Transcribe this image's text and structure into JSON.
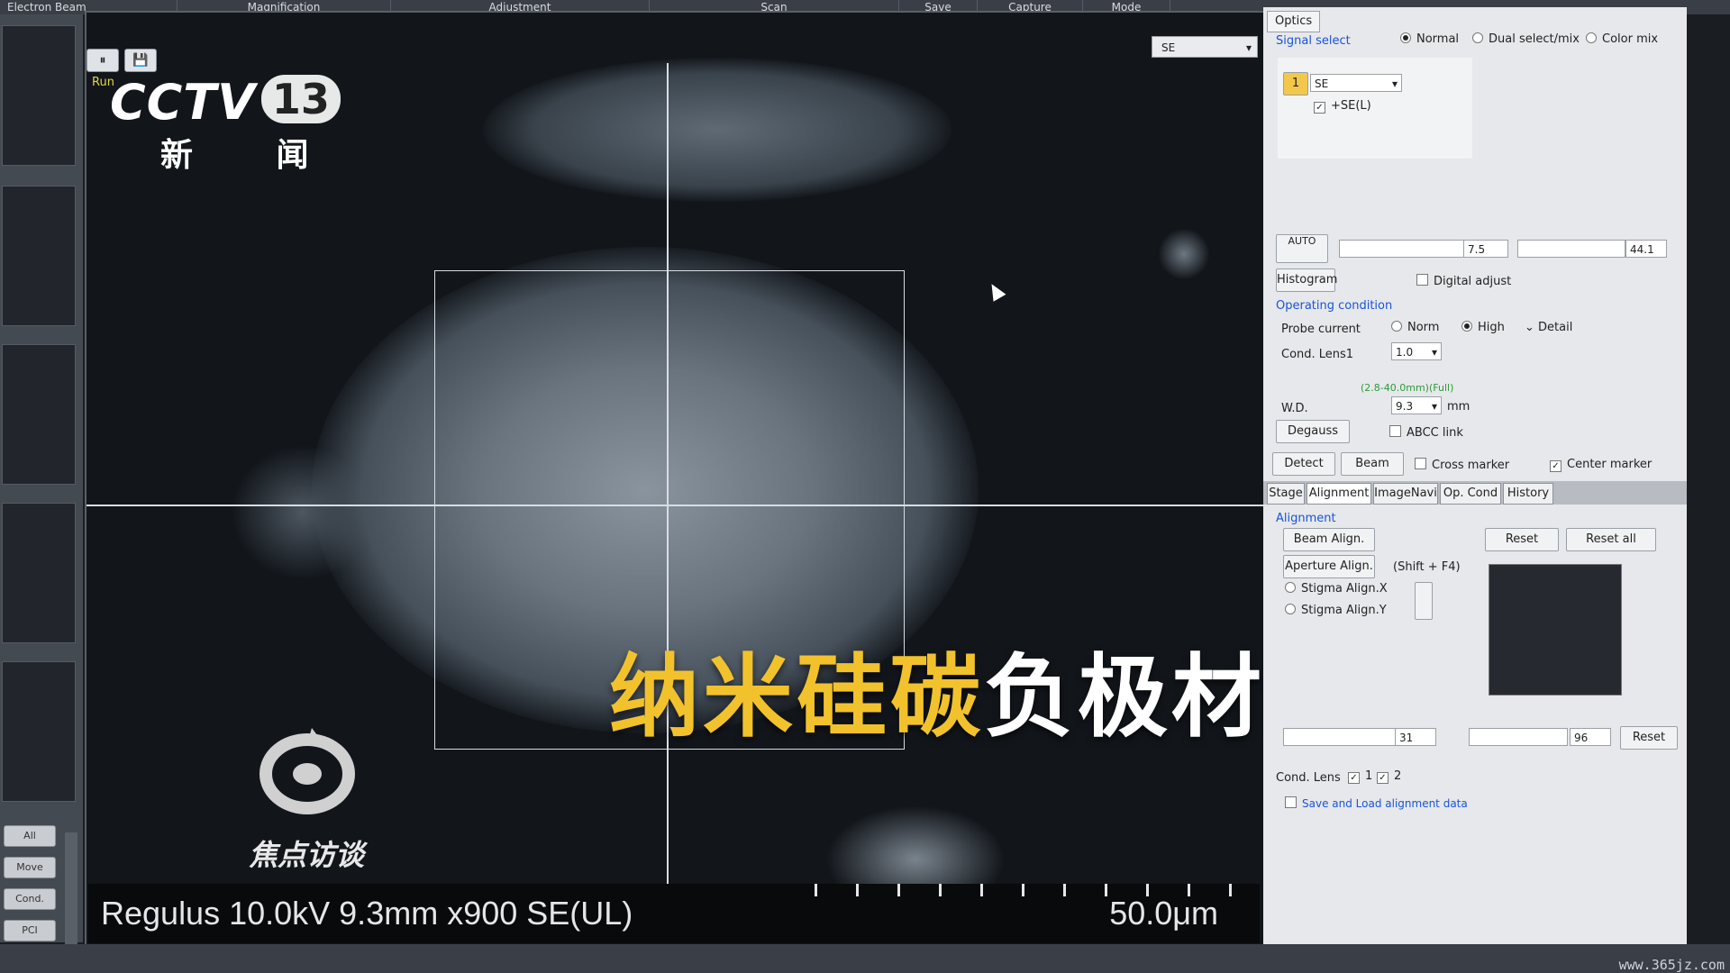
{
  "menu": [
    "Electron Beam",
    "Magnification",
    "Adjustment",
    "Scan",
    "Save",
    "Capture",
    "Mode"
  ],
  "viewer": {
    "run_label": "Run",
    "signal": "SE",
    "info": "Regulus 10.0kV 9.3mm x900 SE(UL)",
    "scale": "50.0μm"
  },
  "left_buttons": [
    "All",
    "Move",
    "Cond.",
    "PCI"
  ],
  "overlay": {
    "channel_logo": "CCTV",
    "channel_number": "13",
    "channel_name": "新 闻",
    "program": "焦点访谈",
    "subtitle_yellow": "纳米硅碳",
    "subtitle_white": "负极材料",
    "watermark": "www.365jz.com"
  },
  "panel": {
    "tab": "Optics",
    "signal_select": "Signal select",
    "modes": [
      "Normal",
      "Dual select/mix",
      "Color mix"
    ],
    "signal_number": "1",
    "signal_value": "SE",
    "signal_sub": "+SE(L)",
    "auto": "AUTO",
    "brightness": "7.5",
    "contrast": "44.1",
    "histogram": "Histogram",
    "digital_adjust": "Digital adjust",
    "operating_condition": "Operating condition",
    "probe_current": "Probe current",
    "probe_opts": [
      "Norm",
      "High",
      "Detail"
    ],
    "cond_lens1": "Cond. Lens1",
    "cond_lens1_val": "1.0",
    "wd_range": "(2.8-40.0mm)(Full)",
    "wd": "W.D.",
    "wd_val": "9.3",
    "wd_unit": "mm",
    "degauss": "Degauss",
    "abcc": "ABCC link",
    "detect": "Detect",
    "beam": "Beam",
    "cross_marker": "Cross marker",
    "center_marker": "Center marker",
    "tabs": [
      "Stage",
      "Alignment",
      "ImageNavi",
      "Op. Cond",
      "History"
    ],
    "alignment": "Alignment",
    "beam_align": "Beam Align.",
    "aperture_align": "Aperture Align.",
    "shortcut": "(Shift + F4)",
    "stigma_x": "Stigma Align.X",
    "stigma_y": "Stigma Align.Y",
    "reset": "Reset",
    "reset_all": "Reset all",
    "val_a": "31",
    "val_b": "96",
    "reset2": "Reset",
    "cond_lens": "Cond. Lens",
    "cl1": "1",
    "cl2": "2",
    "save_load": "Save and Load alignment data"
  }
}
